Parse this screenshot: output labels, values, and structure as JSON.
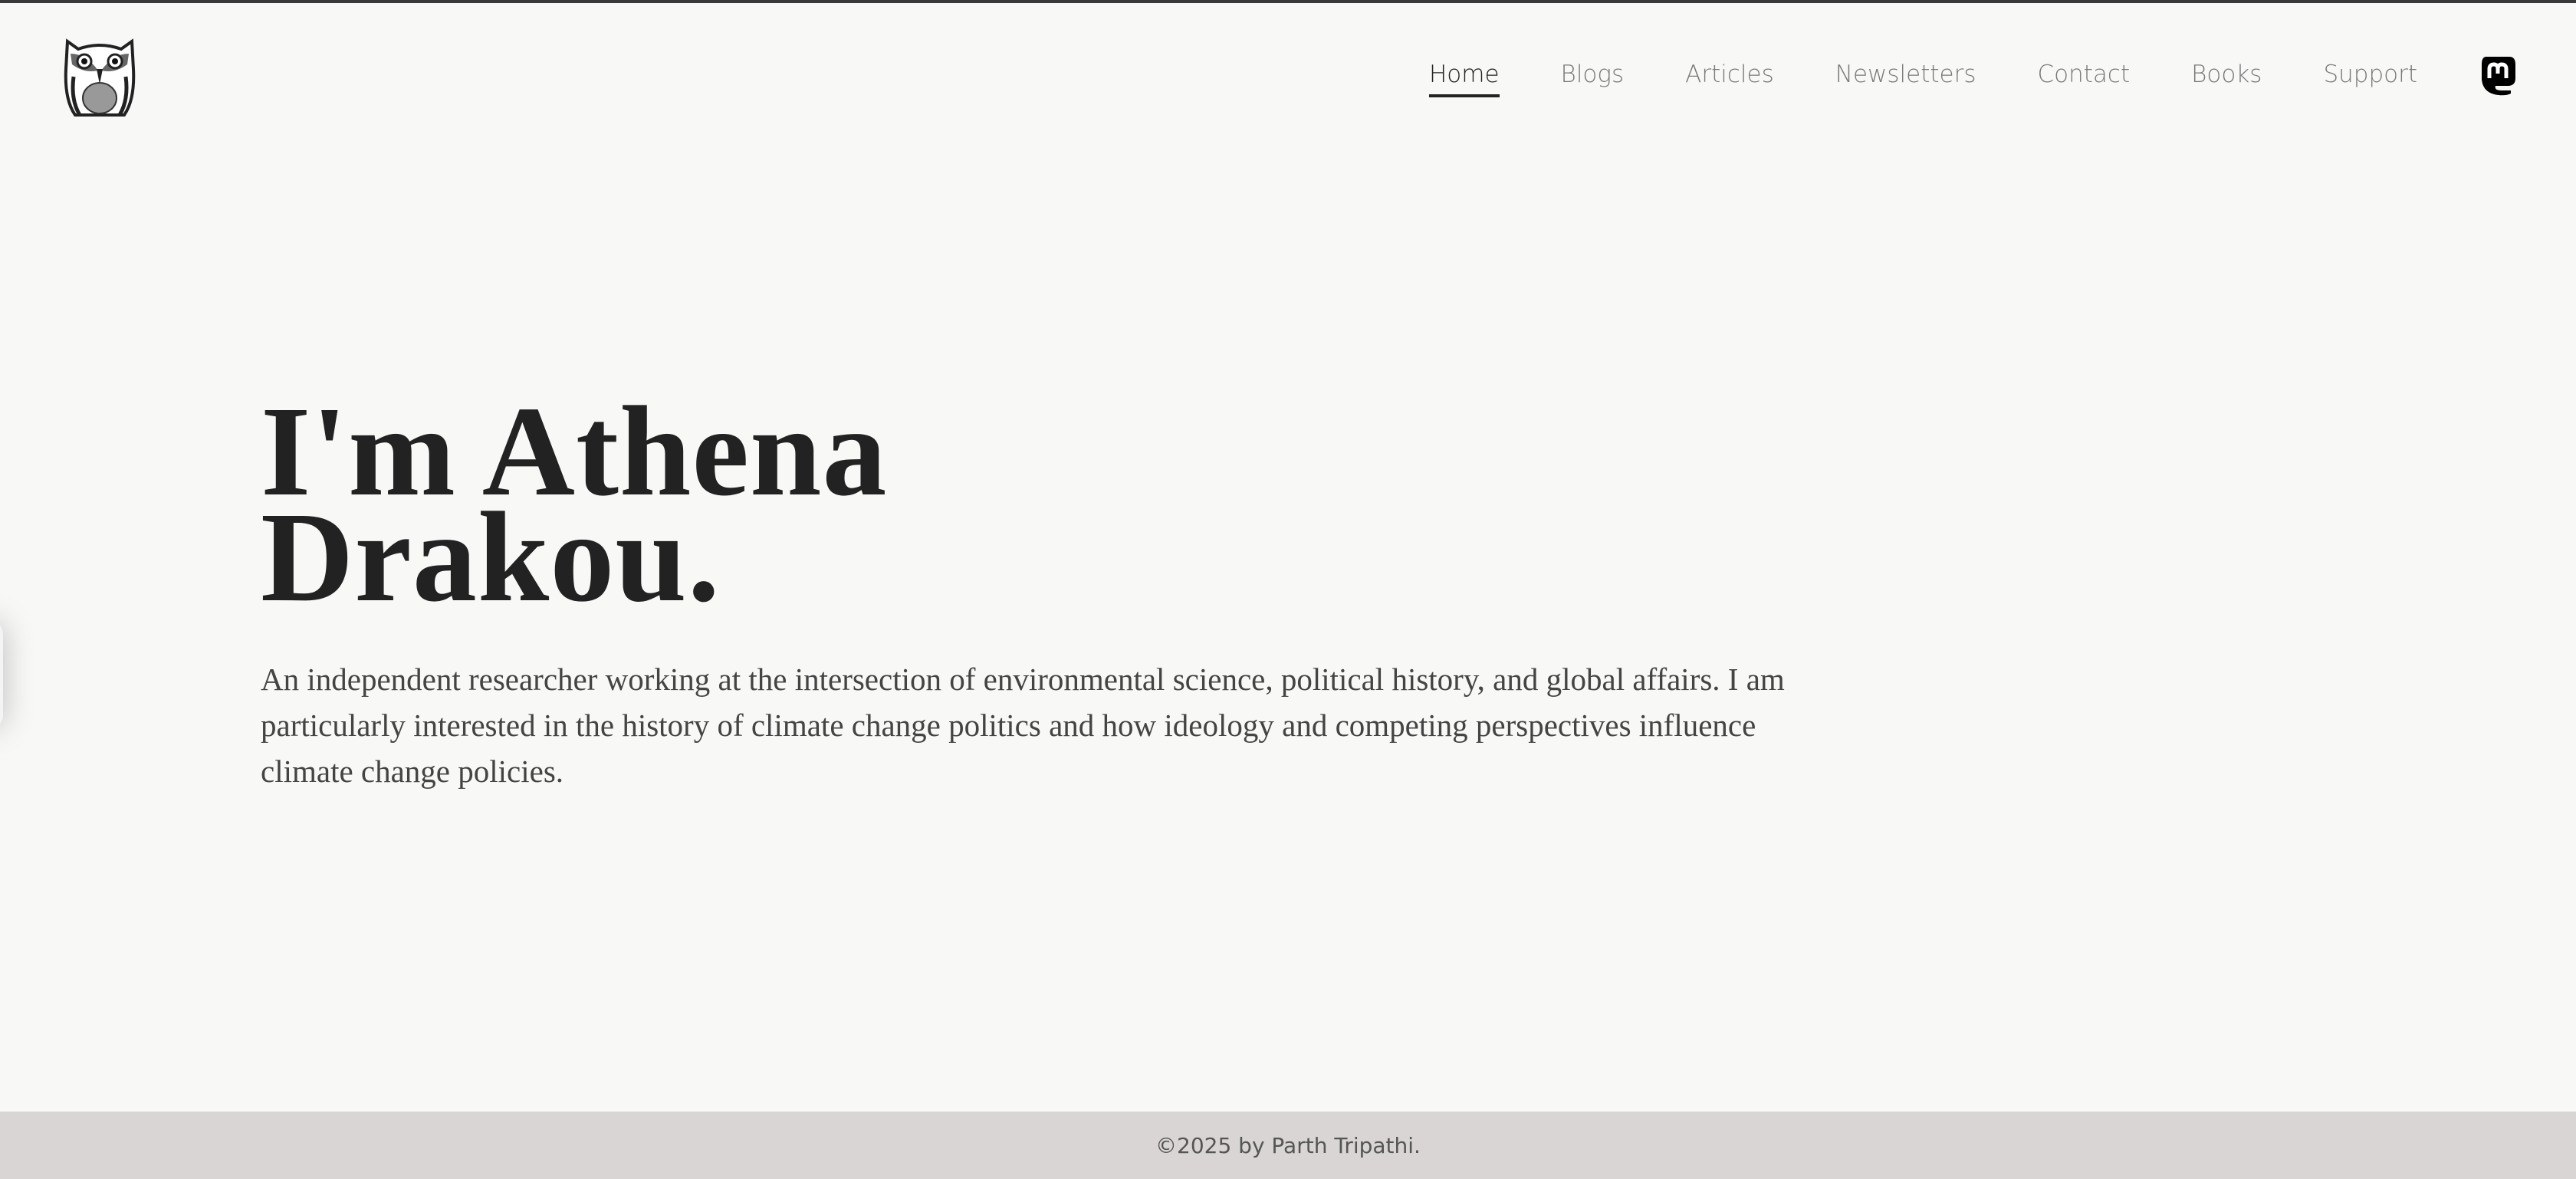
{
  "logo": {
    "alt": "owl logo"
  },
  "nav": {
    "items": [
      {
        "label": "Home",
        "active": true
      },
      {
        "label": "Blogs"
      },
      {
        "label": "Articles"
      },
      {
        "label": "Newsletters"
      },
      {
        "label": "Contact"
      },
      {
        "label": "Books"
      },
      {
        "label": "Support"
      }
    ],
    "social_icon": "mastodon-icon"
  },
  "hero": {
    "title_line1": "I'm Athena",
    "title_line2": "Drakou.",
    "description": "An independent researcher working at the intersection of environmental science, political history, and global affairs. I am particularly interested in the history of climate change politics and how ideology and competing perspectives influence climate change policies."
  },
  "footer": {
    "text": "©2025 by Parth Tripathi."
  }
}
